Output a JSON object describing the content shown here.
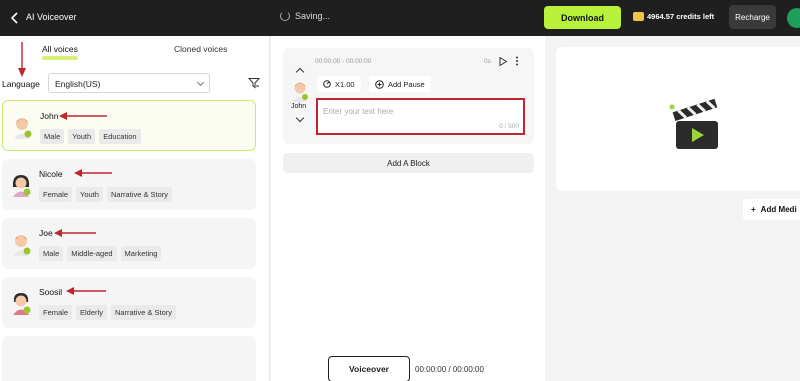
{
  "header": {
    "app_title": "AI Voiceover",
    "status": "Saving...",
    "download_label": "Download",
    "credits": "4964.57 credits left",
    "recharge_label": "Recharge"
  },
  "left_panel": {
    "tabs": [
      {
        "label": "All voices",
        "active": true
      },
      {
        "label": "Cloned voices",
        "active": false
      }
    ],
    "language_label": "Language",
    "language_value": "English(US)",
    "voices": [
      {
        "name": "John",
        "tags": [
          "Male",
          "Youth",
          "Education"
        ],
        "selected": true
      },
      {
        "name": "Nicole",
        "tags": [
          "Female",
          "Youth",
          "Narrative & Story"
        ],
        "selected": false
      },
      {
        "name": "Joe",
        "tags": [
          "Male",
          "Middle-aged",
          "Marketing"
        ],
        "selected": false
      },
      {
        "name": "Soosil",
        "tags": [
          "Female",
          "Elderly",
          "Narrative & Story"
        ],
        "selected": false
      }
    ]
  },
  "editor": {
    "block": {
      "time_range": "00:00:00 - 00:00:00",
      "duration": "0s",
      "voice_name": "John",
      "speed_label": "X1.00",
      "add_pause_label": "Add Pause",
      "text_placeholder": "Enter your text here",
      "char_count": "0 / 500"
    },
    "add_block_label": "Add A Block"
  },
  "right_panel": {
    "add_media_label": "Add Medi"
  },
  "footer": {
    "voiceover_label": "Voiceover",
    "time": "00:00:00 / 00:00:00"
  },
  "colors": {
    "accent": "#b8f23a",
    "topbar": "#1f1f1f",
    "highlight_red": "#c0262d"
  }
}
